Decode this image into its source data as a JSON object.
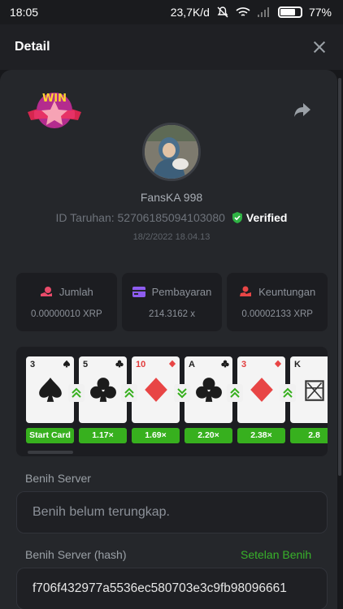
{
  "status_bar": {
    "time": "18:05",
    "network_speed": "23,7K/d",
    "battery": "77%",
    "battery_level": 0.77
  },
  "header": {
    "title": "Detail"
  },
  "player": {
    "name": "FansKA 998",
    "bet_id": "ID Taruhan: 52706185094103080",
    "verified": "Verified",
    "date": "18/2/2022 18.04.13",
    "badge_text": "WIN"
  },
  "stats": [
    {
      "label": "Jumlah",
      "value": "0.00000010 XRP",
      "icon": "bet-amount-icon",
      "color": "#e94b6a"
    },
    {
      "label": "Pembayaran",
      "value": "214.3162 x",
      "icon": "wallet-icon",
      "color": "#8e5cf0"
    },
    {
      "label": "Keuntungan",
      "value": "0.00002133 XRP",
      "icon": "profit-icon",
      "color": "#e84646"
    }
  ],
  "cards": [
    {
      "rank": "3",
      "suit": "spade",
      "color": "black",
      "mult": "Start Card"
    },
    {
      "rank": "5",
      "suit": "club",
      "color": "black",
      "mult": "1.17×"
    },
    {
      "rank": "10",
      "suit": "diamond",
      "color": "red",
      "mult": "1.69×"
    },
    {
      "rank": "A",
      "suit": "club",
      "color": "black",
      "mult": "2.20×"
    },
    {
      "rank": "3",
      "suit": "diamond",
      "color": "red",
      "mult": "2.38×"
    },
    {
      "rank": "K",
      "suit": "king",
      "color": "black",
      "mult": "2.8"
    }
  ],
  "arrows": [
    "up",
    "up",
    "down",
    "up",
    "up"
  ],
  "server_seed": {
    "label": "Benih Server",
    "value": "Benih belum terungkap."
  },
  "server_seed_hash": {
    "label": "Benih Server (hash)",
    "link": "Setelan Benih",
    "value": "f706f432977a5536ec580703e3c9fb98096661"
  },
  "colors": {
    "accent_green": "#38b22a",
    "multiplier_green": "#37b01e",
    "panel": "#25272b"
  }
}
